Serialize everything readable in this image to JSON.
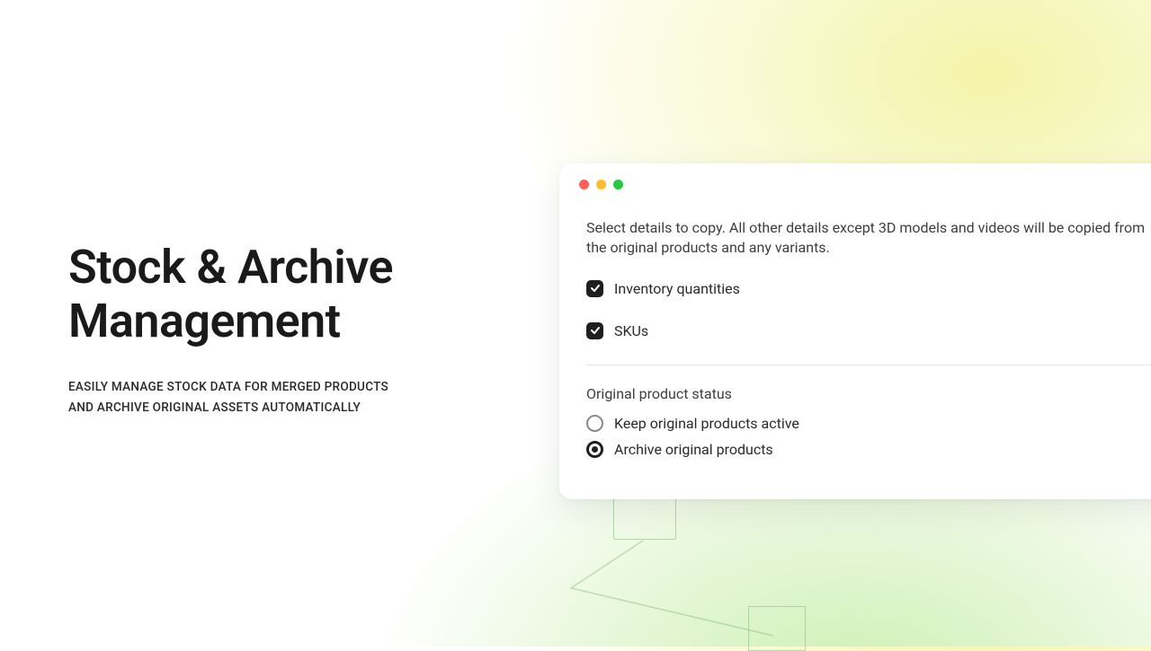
{
  "hero": {
    "title": "Stock & Archive Management",
    "subtitle": "EASILY MANAGE STOCK DATA FOR MERGED PRODUCTS AND ARCHIVE ORIGINAL ASSETS AUTOMATICALLY"
  },
  "dialog": {
    "description": "Select details to copy. All other details except 3D models and videos will be copied from the original products and any variants.",
    "checkboxes": [
      {
        "label": "Inventory quantities",
        "checked": true
      },
      {
        "label": "SKUs",
        "checked": true
      }
    ],
    "status_section": {
      "heading": "Original product status",
      "options": [
        {
          "label": "Keep original products active",
          "selected": false
        },
        {
          "label": "Archive original products",
          "selected": true
        }
      ]
    }
  }
}
